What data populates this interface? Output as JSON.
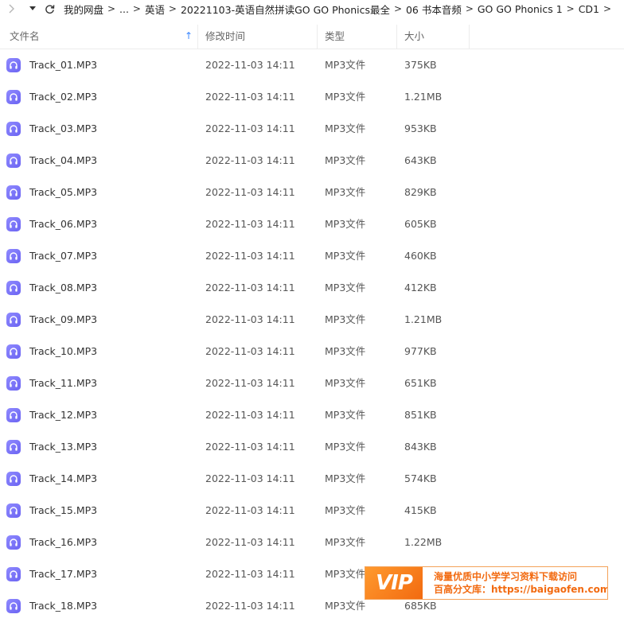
{
  "breadcrumb": {
    "items": [
      "我的网盘",
      "...",
      "英语",
      "20221103-英语自然拼读GO GO Phonics最全",
      "06 书本音频",
      "GO GO Phonics 1",
      "CD1"
    ],
    "separator": ">"
  },
  "columns": {
    "name": "文件名",
    "modified": "修改时间",
    "type": "类型",
    "size": "大小",
    "sort_arrow": "↑"
  },
  "files": [
    {
      "name": "Track_01.MP3",
      "modified": "2022-11-03 14:11",
      "type": "MP3文件",
      "size": "375KB"
    },
    {
      "name": "Track_02.MP3",
      "modified": "2022-11-03 14:11",
      "type": "MP3文件",
      "size": "1.21MB"
    },
    {
      "name": "Track_03.MP3",
      "modified": "2022-11-03 14:11",
      "type": "MP3文件",
      "size": "953KB"
    },
    {
      "name": "Track_04.MP3",
      "modified": "2022-11-03 14:11",
      "type": "MP3文件",
      "size": "643KB"
    },
    {
      "name": "Track_05.MP3",
      "modified": "2022-11-03 14:11",
      "type": "MP3文件",
      "size": "829KB"
    },
    {
      "name": "Track_06.MP3",
      "modified": "2022-11-03 14:11",
      "type": "MP3文件",
      "size": "605KB"
    },
    {
      "name": "Track_07.MP3",
      "modified": "2022-11-03 14:11",
      "type": "MP3文件",
      "size": "460KB"
    },
    {
      "name": "Track_08.MP3",
      "modified": "2022-11-03 14:11",
      "type": "MP3文件",
      "size": "412KB"
    },
    {
      "name": "Track_09.MP3",
      "modified": "2022-11-03 14:11",
      "type": "MP3文件",
      "size": "1.21MB"
    },
    {
      "name": "Track_10.MP3",
      "modified": "2022-11-03 14:11",
      "type": "MP3文件",
      "size": "977KB"
    },
    {
      "name": "Track_11.MP3",
      "modified": "2022-11-03 14:11",
      "type": "MP3文件",
      "size": "651KB"
    },
    {
      "name": "Track_12.MP3",
      "modified": "2022-11-03 14:11",
      "type": "MP3文件",
      "size": "851KB"
    },
    {
      "name": "Track_13.MP3",
      "modified": "2022-11-03 14:11",
      "type": "MP3文件",
      "size": "843KB"
    },
    {
      "name": "Track_14.MP3",
      "modified": "2022-11-03 14:11",
      "type": "MP3文件",
      "size": "574KB"
    },
    {
      "name": "Track_15.MP3",
      "modified": "2022-11-03 14:11",
      "type": "MP3文件",
      "size": "415KB"
    },
    {
      "name": "Track_16.MP3",
      "modified": "2022-11-03 14:11",
      "type": "MP3文件",
      "size": "1.22MB"
    },
    {
      "name": "Track_17.MP3",
      "modified": "2022-11-03 14:11",
      "type": "MP3文件",
      "size": ""
    },
    {
      "name": "Track_18.MP3",
      "modified": "2022-11-03 14:11",
      "type": "MP3文件",
      "size": "685KB"
    }
  ],
  "file_icon": "audio-headphones-icon",
  "watermark": {
    "logo": "VIP",
    "line1": "海量优质中小学学习资料下载访问",
    "line2": "百高分文库：https://baigaofen.com"
  },
  "colors": {
    "icon_purple": "#7b73f7",
    "sort_arrow": "#3a86ff",
    "watermark_orange": "#f26a10"
  }
}
